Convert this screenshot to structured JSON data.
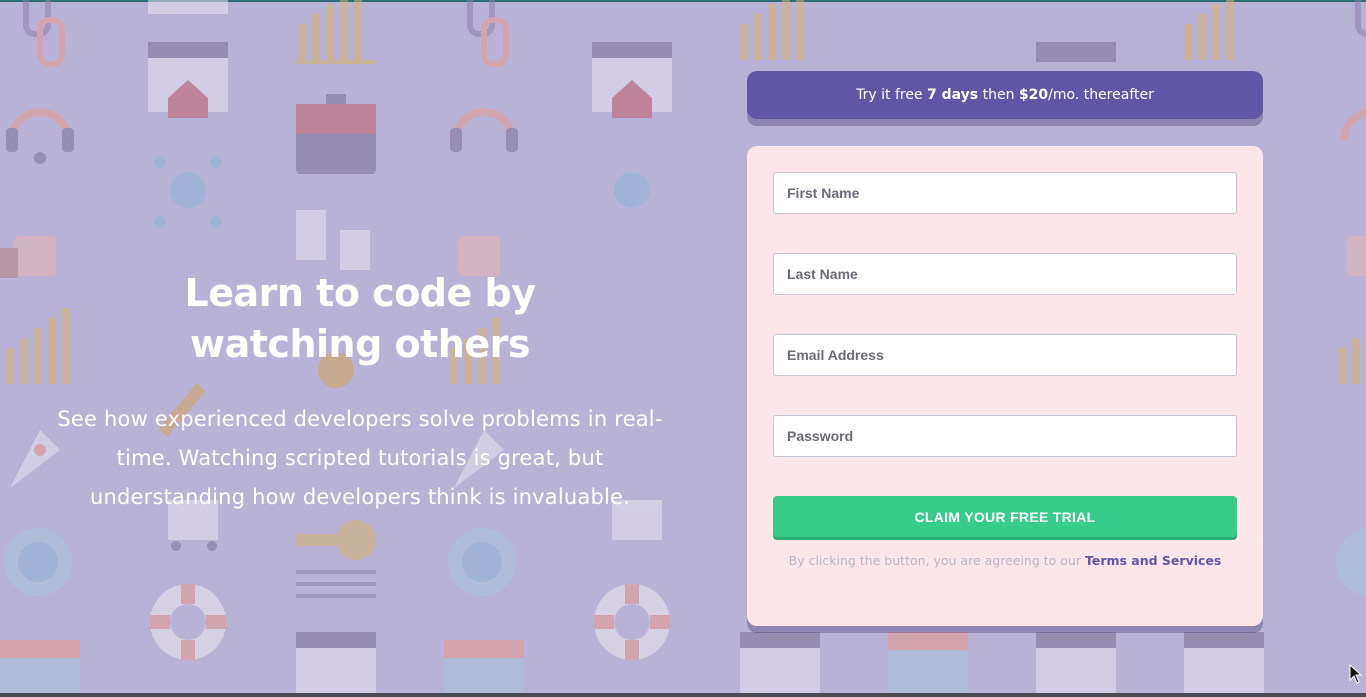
{
  "hero": {
    "title_line1": "Learn to code by",
    "title_line2": "watching others",
    "description": "See how experienced developers solve problems in real-time. Watching scripted tutorials is great, but understanding how developers think is invaluable."
  },
  "promo": {
    "prefix": "Try it free ",
    "days": "7 days",
    "middle": " then ",
    "price": "$20",
    "suffix": "/mo. thereafter"
  },
  "form": {
    "first_name_placeholder": "First Name",
    "last_name_placeholder": "Last Name",
    "email_placeholder": "Email Address",
    "password_placeholder": "Password",
    "submit_label": "CLAIM YOUR FREE TRIAL",
    "terms_prefix": "By clicking the button, you are agreeing to our ",
    "terms_link": "Terms and Services"
  },
  "colors": {
    "background": "#b8b3d6",
    "promo": "#6155a6",
    "card": "#fde5ea",
    "button": "#38cc8c"
  },
  "icons": [
    "link-icon",
    "browser-home-icon",
    "bar-chart-icon",
    "headset-icon",
    "toolbox-icon",
    "network-cloud-icon",
    "thumbs-up-icon",
    "rocket-icon",
    "globe-gear-icon",
    "lifebuoy-icon",
    "calendar-icon",
    "key-icon",
    "cart-icon"
  ]
}
